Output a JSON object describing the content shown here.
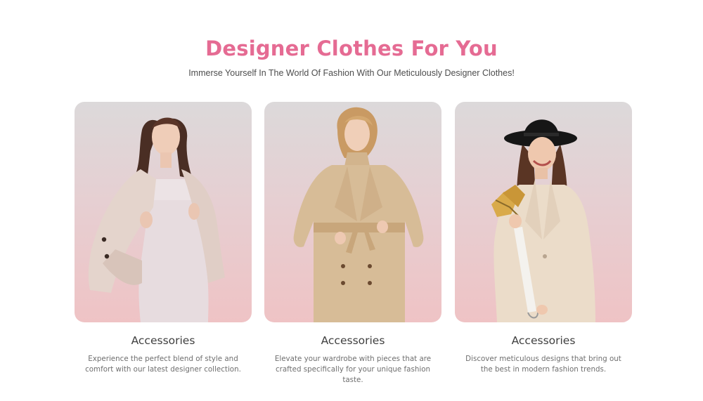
{
  "header": {
    "title": "Designer Clothes For You",
    "subtitle": "Immerse Yourself In The World Of Fashion With Our Meticulously Designer Clothes!"
  },
  "colors": {
    "accent": "#e56b93",
    "card_gradient_top": "#dcd9da",
    "card_gradient_bottom": "#efc3c5"
  },
  "cards": [
    {
      "title": "Accessories",
      "description": "Experience the perfect blend of style and comfort with our latest designer collection."
    },
    {
      "title": "Accessories",
      "description": "Elevate your wardrobe with pieces that are crafted specifically for your unique fashion taste."
    },
    {
      "title": "Accessories",
      "description": "Discover meticulous designs that bring out the best in modern fashion trends."
    }
  ]
}
